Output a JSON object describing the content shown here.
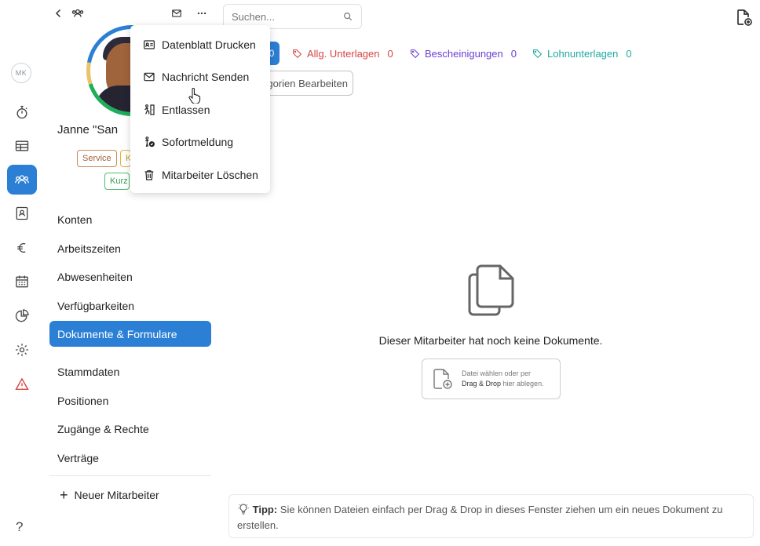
{
  "rail": {
    "avatar_initials": "MK",
    "items": [
      {
        "icon": "stopwatch-icon"
      },
      {
        "icon": "table-icon"
      },
      {
        "icon": "users-icon",
        "active": true
      },
      {
        "icon": "contact-card-icon"
      },
      {
        "icon": "euro-icon"
      },
      {
        "icon": "calendar-icon"
      },
      {
        "icon": "pie-chart-icon"
      },
      {
        "icon": "gear-icon"
      },
      {
        "icon": "warning-icon"
      }
    ],
    "help_label": "?"
  },
  "employee": {
    "name": "Janne \"San",
    "tags": [
      "Service",
      "K",
      "Kurz"
    ]
  },
  "nav": {
    "items": [
      {
        "label": "Konten"
      },
      {
        "label": "Arbeitszeiten"
      },
      {
        "label": "Abwesenheiten"
      },
      {
        "label": "Verfügbarkeiten"
      },
      {
        "label": "Dokumente & Formulare",
        "active": true
      },
      {
        "label": "Stammdaten"
      },
      {
        "label": "Positionen"
      },
      {
        "label": "Zugänge & Rechte"
      },
      {
        "label": "Verträge"
      }
    ],
    "new_employee": "Neuer Mitarbeiter"
  },
  "search": {
    "placeholder": "Suchen..."
  },
  "categories": {
    "active_count": "0",
    "items": [
      {
        "label": "Allg. Unterlagen",
        "count": "0",
        "color": "#d64545"
      },
      {
        "label": "Bescheinigungen",
        "count": "0",
        "color": "#6b3fd4"
      },
      {
        "label": "Lohnunterlagen",
        "count": "0",
        "color": "#1fa8a0"
      }
    ],
    "edit_label": "gorien Bearbeiten"
  },
  "menu": {
    "items": [
      {
        "label": "Datenblatt Drucken",
        "icon": "id-card-icon"
      },
      {
        "label": "Nachricht Senden",
        "icon": "mail-icon"
      },
      {
        "label": "Entlassen",
        "icon": "exit-person-icon"
      },
      {
        "label": "Sofortmeldung",
        "icon": "person-check-icon"
      },
      {
        "label": "Mitarbeiter Löschen",
        "icon": "trash-icon"
      }
    ]
  },
  "empty_state": {
    "message": "Dieser Mitarbeiter hat noch keine Dokumente.",
    "dropzone_line1": "Datei wählen oder per",
    "dropzone_bold": "Drag & Drop",
    "dropzone_line2": " hier ablegen."
  },
  "tip": {
    "label": "Tipp:",
    "text": " Sie können Dateien einfach per Drag & Drop in dieses Fenster ziehen um ein neues Dokument zu erstellen."
  }
}
